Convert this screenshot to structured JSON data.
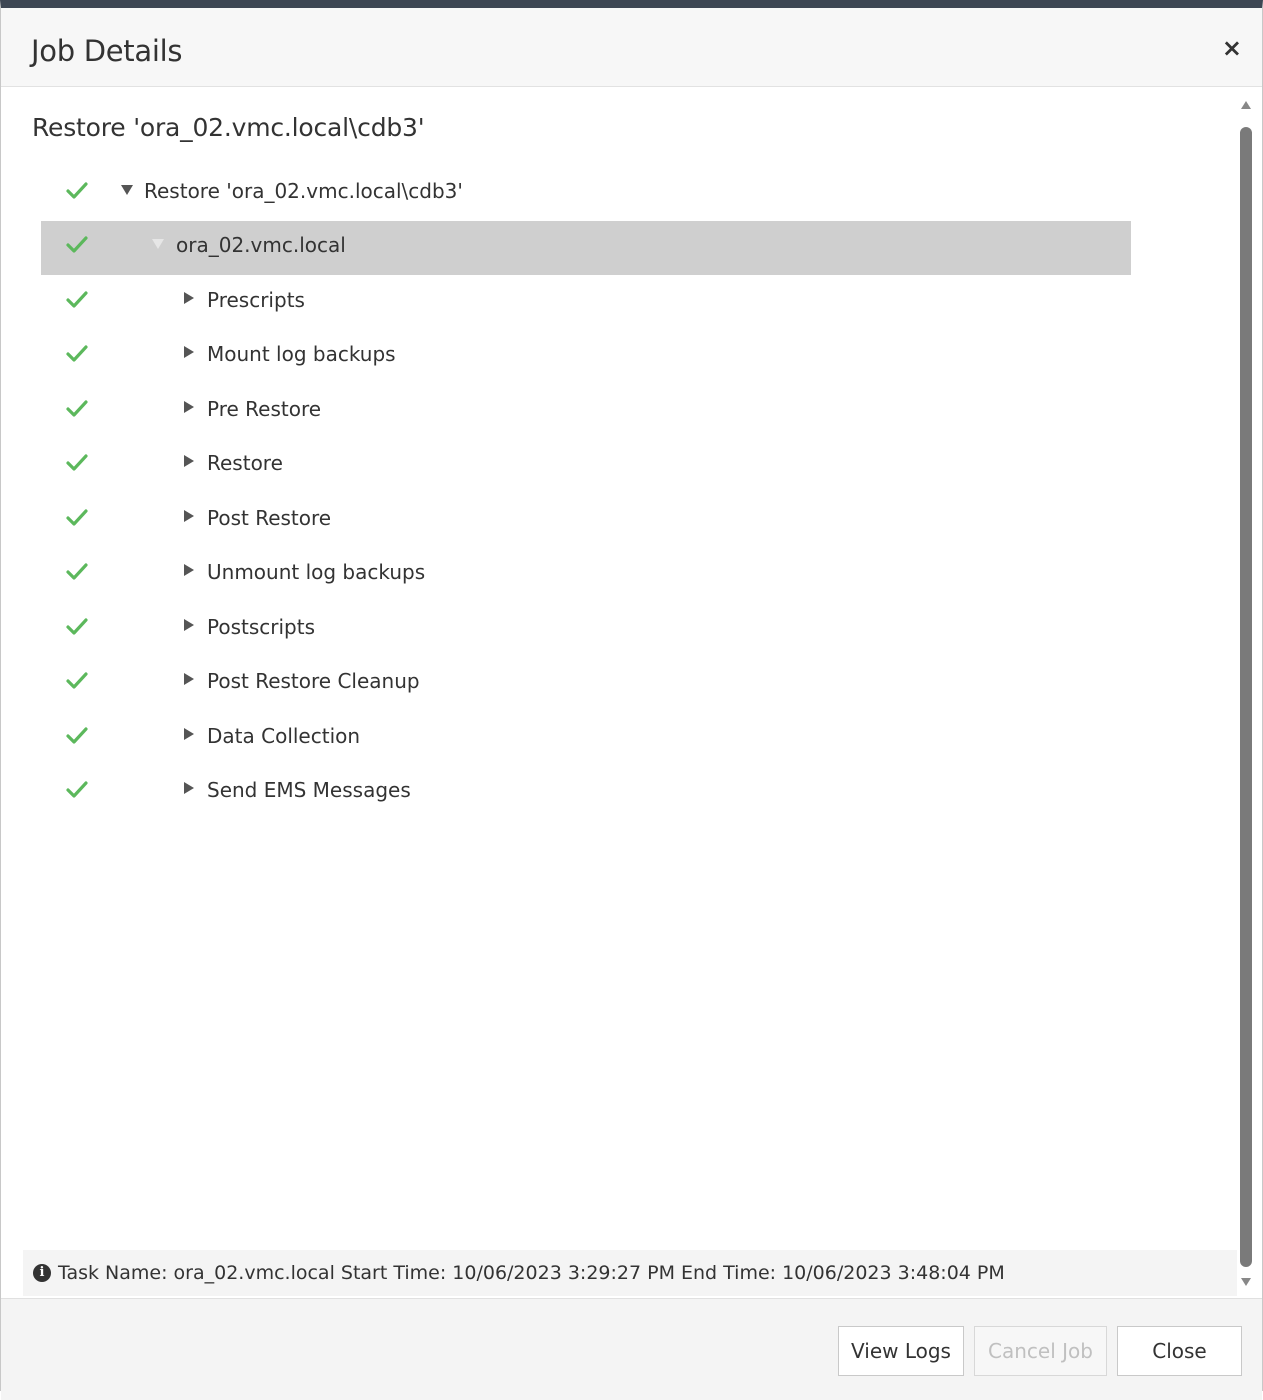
{
  "dialog": {
    "title": "Job Details",
    "close_glyph": "×"
  },
  "restore_title": "Restore 'ora_02.vmc.local\\cdb3'",
  "tree": {
    "root": {
      "label": "Restore 'ora_02.vmc.local\\cdb3'",
      "status": "success",
      "expanded": true
    },
    "host": {
      "label": "ora_02.vmc.local",
      "status": "success",
      "expanded": true,
      "selected": true
    },
    "steps": [
      {
        "label": "Prescripts",
        "status": "success"
      },
      {
        "label": "Mount log backups",
        "status": "success"
      },
      {
        "label": "Pre Restore",
        "status": "success"
      },
      {
        "label": "Restore",
        "status": "success"
      },
      {
        "label": "Post Restore",
        "status": "success"
      },
      {
        "label": "Unmount log backups",
        "status": "success"
      },
      {
        "label": "Postscripts",
        "status": "success"
      },
      {
        "label": "Post Restore Cleanup",
        "status": "success"
      },
      {
        "label": "Data Collection",
        "status": "success"
      },
      {
        "label": "Send EMS Messages",
        "status": "success"
      }
    ]
  },
  "info": {
    "icon": "info-circle-icon",
    "text": "Task Name: ora_02.vmc.local Start Time: 10/06/2023 3:29:27 PM End Time: 10/06/2023 3:48:04 PM"
  },
  "buttons": {
    "view_logs": "View Logs",
    "cancel_job": "Cancel Job",
    "close": "Close"
  },
  "colors": {
    "check": "#5cb85c",
    "selected_row": "#cfcfcf",
    "header_border": "#3d4653"
  }
}
